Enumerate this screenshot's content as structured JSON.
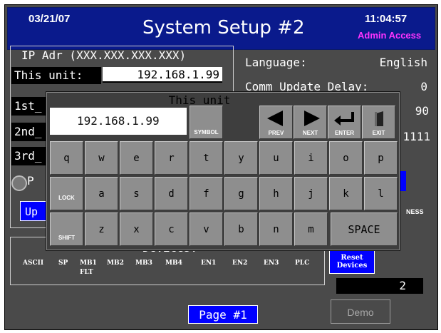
{
  "header": {
    "date": "03/21/07",
    "title": "System Setup #2",
    "time": "11:04:57",
    "access": "Admin Access"
  },
  "ip_panel": {
    "header": "IP Adr (XXX.XXX.XXX.XXX)",
    "this_unit_label": "This unit:",
    "this_unit_value": "192.168.1.99",
    "row_1_label": "1st_",
    "row_2_label": "2nd_",
    "row_3_label": "3rd_",
    "radio_fragment": "P",
    "update_fragment": "Up"
  },
  "settings": {
    "language_label": "Language:",
    "language_value": "English",
    "comm_label": "Comm Update Delay:",
    "comm_value": "0",
    "value_2": "90",
    "value_3": "1111",
    "ness_fragment": "NESS"
  },
  "devices": {
    "title": "Devices:",
    "items": [
      "ASCII",
      "SP",
      "MB1",
      "MB2",
      "MB3",
      "MB4",
      "EN1",
      "EN2",
      "EN3",
      "PLC"
    ],
    "mb1_sub": "FLT",
    "reset_line1": "Reset",
    "reset_line2": "Devices",
    "count": "2"
  },
  "footer": {
    "page_button": "Page #1",
    "demo_button": "Demo"
  },
  "keyboard": {
    "title": "This unit",
    "display_value": "192.168.1.99",
    "symbol_key": "SYMBOL",
    "prev_key": "PREV",
    "next_key": "NEXT",
    "enter_key": "ENTER",
    "exit_key": "EXIT",
    "lock_key": "LOCK",
    "shift_key": "SHIFT",
    "space_key": "SPACE",
    "row1": [
      "q",
      "w",
      "e",
      "r",
      "t",
      "y",
      "u",
      "i",
      "o",
      "p"
    ],
    "row2": [
      "a",
      "s",
      "d",
      "f",
      "g",
      "h",
      "j",
      "k",
      "l"
    ],
    "row3": [
      "z",
      "x",
      "c",
      "v",
      "b",
      "n",
      "m"
    ]
  },
  "colors": {
    "header_bg": "#0a1a8c",
    "access_text": "#ff33ff",
    "button_blue": "#0000ff",
    "panel_bg": "#4a4a4a",
    "key_face": "#8e8e8e"
  }
}
